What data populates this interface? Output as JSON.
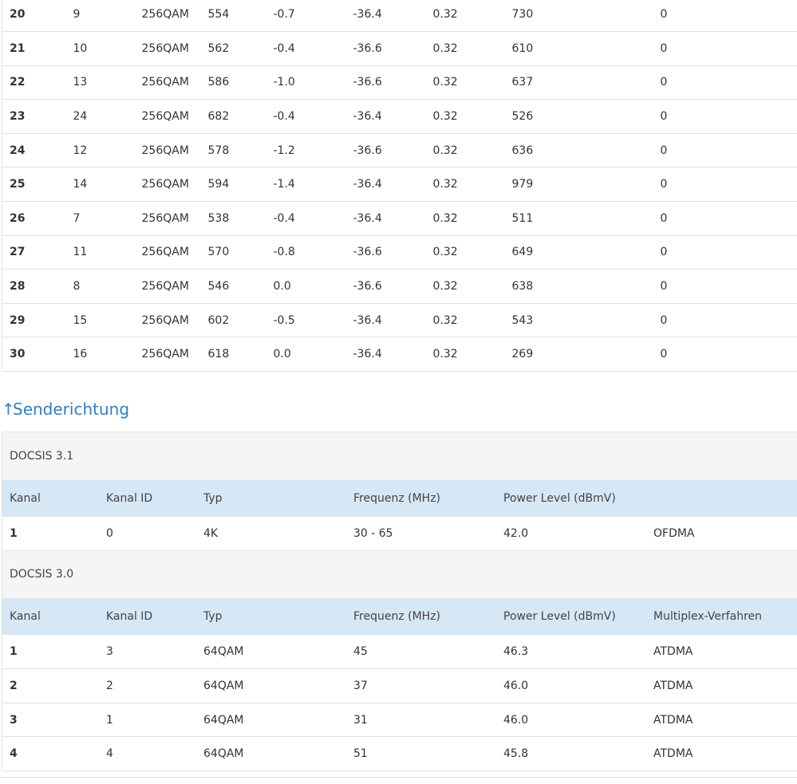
{
  "downstream": {
    "rows": [
      [
        "20",
        "9",
        "256QAM",
        "554",
        "-0.7",
        "-36.4",
        "0.32",
        "730",
        "0"
      ],
      [
        "21",
        "10",
        "256QAM",
        "562",
        "-0.4",
        "-36.6",
        "0.32",
        "610",
        "0"
      ],
      [
        "22",
        "13",
        "256QAM",
        "586",
        "-1.0",
        "-36.6",
        "0.32",
        "637",
        "0"
      ],
      [
        "23",
        "24",
        "256QAM",
        "682",
        "-0.4",
        "-36.4",
        "0.32",
        "526",
        "0"
      ],
      [
        "24",
        "12",
        "256QAM",
        "578",
        "-1.2",
        "-36.6",
        "0.32",
        "636",
        "0"
      ],
      [
        "25",
        "14",
        "256QAM",
        "594",
        "-1.4",
        "-36.4",
        "0.32",
        "979",
        "0"
      ],
      [
        "26",
        "7",
        "256QAM",
        "538",
        "-0.4",
        "-36.4",
        "0.32",
        "511",
        "0"
      ],
      [
        "27",
        "11",
        "256QAM",
        "570",
        "-0.8",
        "-36.6",
        "0.32",
        "649",
        "0"
      ],
      [
        "28",
        "8",
        "256QAM",
        "546",
        "0.0",
        "-36.6",
        "0.32",
        "638",
        "0"
      ],
      [
        "29",
        "15",
        "256QAM",
        "602",
        "-0.5",
        "-36.4",
        "0.32",
        "543",
        "0"
      ],
      [
        "30",
        "16",
        "256QAM",
        "618",
        "0.0",
        "-36.4",
        "0.32",
        "269",
        "0"
      ]
    ]
  },
  "upstream": {
    "title_arrow": "↑",
    "title": "Senderichtung",
    "docsis31": {
      "label": "DOCSIS 3.1",
      "headers": [
        "Kanal",
        "Kanal ID",
        "Typ",
        "Frequenz (MHz)",
        "Power Level (dBmV)",
        ""
      ],
      "rows": [
        [
          "1",
          "0",
          "4K",
          "30 - 65",
          "42.0",
          "OFDMA"
        ]
      ]
    },
    "docsis30": {
      "label": "DOCSIS 3.0",
      "headers": [
        "Kanal",
        "Kanal ID",
        "Typ",
        "Frequenz (MHz)",
        "Power Level (dBmV)",
        "Multiplex-Verfahren"
      ],
      "rows": [
        [
          "1",
          "3",
          "64QAM",
          "45",
          "46.3",
          "ATDMA"
        ],
        [
          "2",
          "2",
          "64QAM",
          "37",
          "46.0",
          "ATDMA"
        ],
        [
          "3",
          "1",
          "64QAM",
          "31",
          "46.0",
          "ATDMA"
        ],
        [
          "4",
          "4",
          "64QAM",
          "51",
          "45.8",
          "ATDMA"
        ]
      ]
    }
  },
  "colors": {
    "accent": "#2f7fc6",
    "header_bg": "#d6e7f5",
    "group_bg": "#f5f5f4"
  }
}
